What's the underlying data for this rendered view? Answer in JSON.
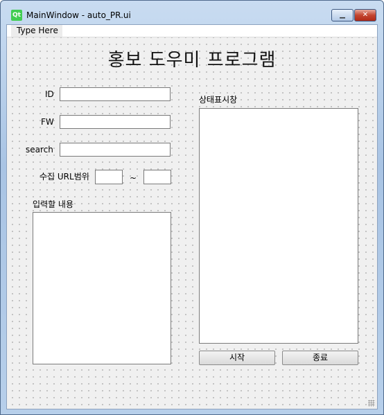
{
  "window": {
    "title": "MainWindow - auto_PR.ui",
    "logo_text": "Qt",
    "minimize_glyph": "▁",
    "close_glyph": "✕"
  },
  "menubar": {
    "item": "Type Here"
  },
  "main_title": "홍보 도우미 프로그램",
  "form": {
    "id_label": "ID",
    "fw_label": "FW",
    "search_label": "search",
    "url_range_label": "수집 URL범위",
    "range_separator": "~",
    "content_label": "입력할 내용"
  },
  "status": {
    "label": "상태표시창"
  },
  "buttons": {
    "start": "시작",
    "exit": "종료"
  }
}
